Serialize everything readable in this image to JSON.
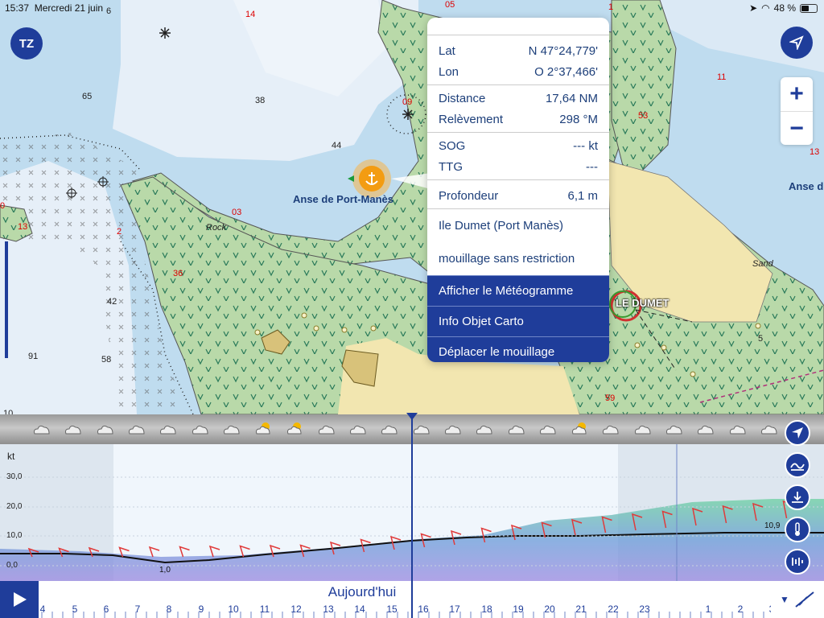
{
  "status_bar": {
    "time": "15:37",
    "date": "Mercredi 21 juin",
    "battery": "48 %",
    "battery_fraction": 0.48
  },
  "app": {
    "logo": "TZ"
  },
  "map": {
    "place_names": [
      "Anse de Port-Manès",
      "Anse d",
      "LE DUMET"
    ],
    "labels": {
      "rock": "Rock",
      "sand": "Sand",
      "s65": "65",
      "s38": "38",
      "s44": "44",
      "s42": "42",
      "s91": "91",
      "s58": "58",
      "s14": "14",
      "s11": "11",
      "s13r": "13",
      "s03": "03",
      "s09": "09",
      "s05": "05",
      "s1": "1",
      "s13": "13",
      "s2": "2",
      "s36": "36",
      "s53": "53",
      "s59": "59",
      "s5": "5",
      "s0": "0",
      "s10": "10",
      "s6": "6"
    },
    "icons": [
      "tz-logo-icon",
      "locate-arrow-icon",
      "zoom-in-icon",
      "zoom-out-icon",
      "anchorage-icon"
    ]
  },
  "zoom": {
    "plus": "+",
    "minus": "−"
  },
  "popup": {
    "lat_label": "Lat",
    "lat_value": "N 47°24,779'",
    "lon_label": "Lon",
    "lon_value": "O 2°37,466'",
    "distance_label": "Distance",
    "distance_value": "17,64 NM",
    "bearing_label": "Relèvement",
    "bearing_value": "298 °M",
    "sog_label": "SOG",
    "sog_value": "--- kt",
    "ttg_label": "TTG",
    "ttg_value": "---",
    "depth_label": "Profondeur",
    "depth_value": "6,1 m",
    "name": "Ile Dumet (Port Manès)",
    "description": "mouillage sans restriction",
    "actions": [
      "Afficher le Météogramme",
      "Info Objet Carto",
      "Déplacer le mouillage"
    ]
  },
  "graph": {
    "unit": "kt",
    "yticks": [
      "30,0",
      "20,0",
      "10,0",
      "0,0"
    ],
    "min_label": "1,0",
    "max_label": "10,9",
    "weather_icons": [
      "cloud",
      "cloud",
      "cloud",
      "cloud",
      "cloud",
      "cloud",
      "cloud",
      "sun-cloud",
      "sun-cloud",
      "cloud",
      "cloud",
      "cloud",
      "cloud",
      "cloud",
      "cloud",
      "cloud",
      "cloud",
      "sun-cloud",
      "cloud",
      "cloud",
      "cloud",
      "cloud",
      "cloud",
      "cloud",
      "cloud",
      "cloud"
    ]
  },
  "timeline": {
    "today": "Aujourd'hui",
    "hours": [
      "4",
      "5",
      "6",
      "7",
      "8",
      "9",
      "10",
      "11",
      "12",
      "13",
      "14",
      "15",
      "16",
      "17",
      "18",
      "19",
      "20",
      "21",
      "22",
      "23",
      "1",
      "2",
      "3"
    ]
  },
  "side_buttons": [
    "navigate-icon",
    "wave-icon",
    "tide-icon",
    "thermometer-icon",
    "current-icon"
  ],
  "colors": {
    "accent": "#1f3d9a",
    "land": "#b9d9a9",
    "shallow": "#bfdcef",
    "deep": "#e8f0f8",
    "sand": "#f2e6b0"
  }
}
